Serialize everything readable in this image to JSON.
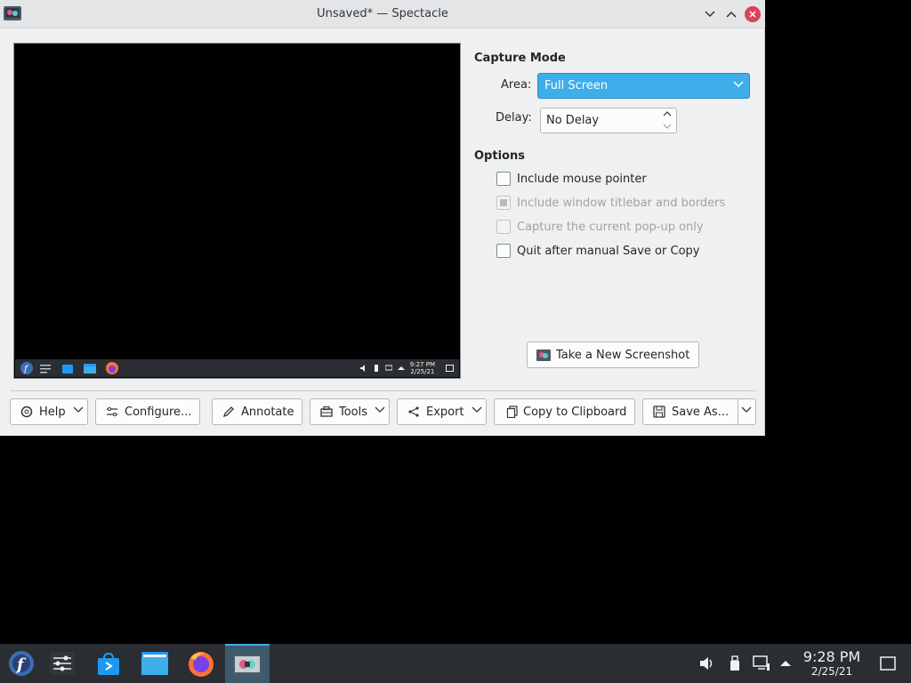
{
  "window": {
    "title": "Unsaved* — Spectacle"
  },
  "capture_mode": {
    "heading": "Capture Mode",
    "area_label": "Area:",
    "area_value": "Full Screen",
    "delay_label": "Delay:",
    "delay_value": "No Delay"
  },
  "options": {
    "heading": "Options",
    "items": [
      {
        "label": "Include mouse pointer",
        "checked": false,
        "enabled": true
      },
      {
        "label": "Include window titlebar and borders",
        "checked": "partial",
        "enabled": false
      },
      {
        "label": "Capture the current pop-up only",
        "checked": false,
        "enabled": false
      },
      {
        "label": "Quit after manual Save or Copy",
        "checked": false,
        "enabled": true
      }
    ]
  },
  "take_screenshot_label": "Take a New Screenshot",
  "bottom_bar": {
    "help": "Help",
    "configure": "Configure...",
    "annotate": "Annotate",
    "tools": "Tools",
    "export": "Export",
    "copy": "Copy to Clipboard",
    "save": "Save As..."
  },
  "preview": {
    "clock_time": "9:27 PM",
    "clock_date": "2/25/21"
  },
  "taskbar": {
    "apps": [
      "fedora-launcher-icon",
      "settings-icon",
      "discover-store-icon",
      "dolphin-files-icon",
      "firefox-icon",
      "spectacle-icon"
    ],
    "clock_time": "9:28 PM",
    "clock_date": "2/25/21"
  },
  "colors": {
    "accent": "#3daee9",
    "close": "#da4453",
    "panel": "#2a2e32",
    "window_bg": "#eff0f1"
  }
}
